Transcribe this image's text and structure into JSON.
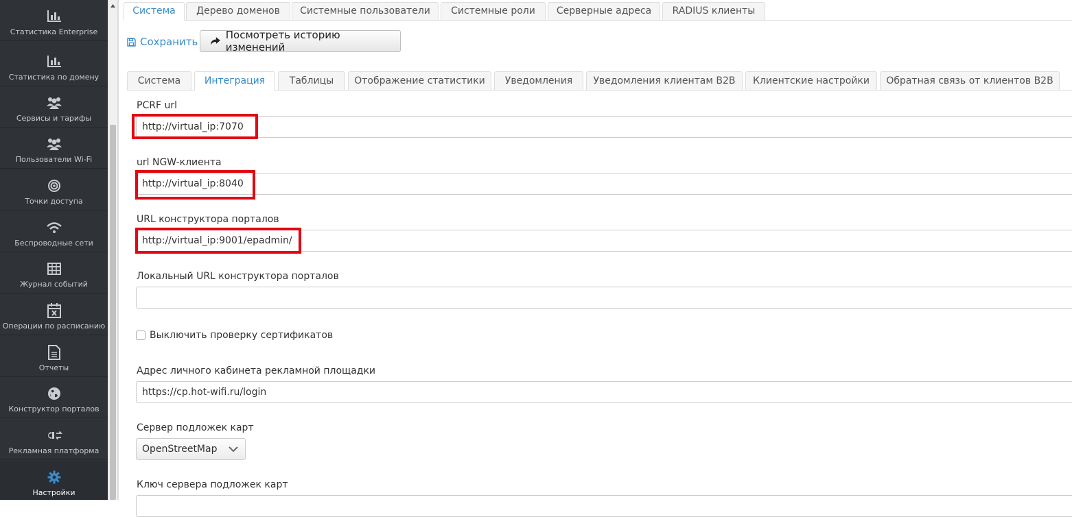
{
  "sidebar": {
    "items": [
      {
        "label": "Статистика Enterprise",
        "icon": "bar-chart-icon"
      },
      {
        "label": "Статистика по домену",
        "icon": "bar-chart-icon"
      },
      {
        "label": "Сервисы и тарифы",
        "icon": "users-icon"
      },
      {
        "label": "Пользователи Wi-Fi",
        "icon": "users-icon"
      },
      {
        "label": "Точки доступа",
        "icon": "target-icon"
      },
      {
        "label": "Беспроводные сети",
        "icon": "wifi-icon"
      },
      {
        "label": "Журнал событий",
        "icon": "table-icon"
      },
      {
        "label": "Операции по расписанию",
        "icon": "calendar-x-icon"
      },
      {
        "label": "Отчеты",
        "icon": "document-icon"
      },
      {
        "label": "Конструктор порталов",
        "icon": "globe-icon"
      },
      {
        "label": "Рекламная платформа",
        "icon": "ad-exchange-icon"
      },
      {
        "label": "Настройки",
        "icon": "gear-icon"
      }
    ],
    "active_index": 11,
    "active_color": "#3a8cc8"
  },
  "top_tabs": [
    "Система",
    "Дерево доменов",
    "Системные пользователи",
    "Системные роли",
    "Серверные адреса",
    "RADIUS клиенты"
  ],
  "top_tabs_active": 0,
  "toolbar": {
    "save_label": "Сохранить",
    "history_label": "Посмотреть историю изменений"
  },
  "sub_tabs": [
    "Система",
    "Интеграция",
    "Таблицы",
    "Отображение статистики",
    "Уведомления",
    "Уведомления клиентам B2B",
    "Клиентские настройки",
    "Обратная связь от клиентов B2B"
  ],
  "sub_tabs_active": 1,
  "form": {
    "pcrf_label": "PCRF url",
    "pcrf_value": "http://virtual_ip:7070",
    "ngw_label": "url NGW-клиента",
    "ngw_value": "http://virtual_ip:8040",
    "portal_label": "URL конструктора порталов",
    "portal_value": "http://virtual_ip:9001/epadmin/",
    "local_portal_label": "Локальный URL конструктора порталов",
    "local_portal_value": "",
    "cert_check_label": "Выключить проверку сертификатов",
    "cert_check_checked": false,
    "ad_cabinet_label": "Адрес личного кабинета рекламной площадки",
    "ad_cabinet_value": "https://cp.hot-wifi.ru/login",
    "map_server_label": "Сервер подложек карт",
    "map_server_value": "OpenStreetMap",
    "map_key_label": "Ключ сервера подложек карт"
  },
  "colors": {
    "accent": "#3a8cc8",
    "highlight": "#e30613",
    "sidebar_bg": "#2f3236"
  }
}
